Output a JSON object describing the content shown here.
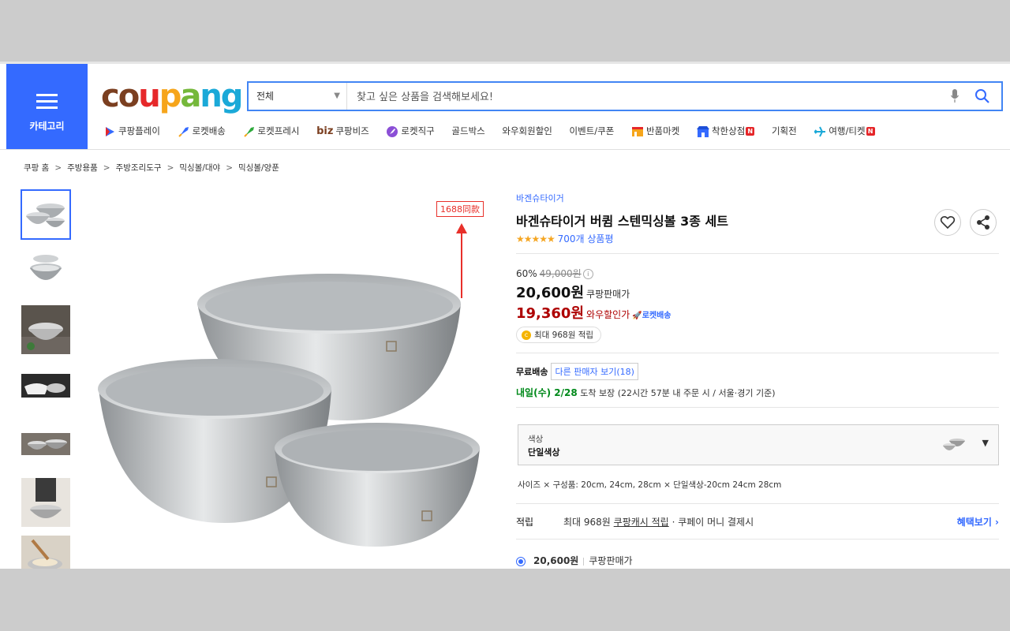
{
  "header": {
    "category_label": "카테고리",
    "search_scope": "전체",
    "search_placeholder": "찾고 싶은 상품을 검색해보세요!",
    "brand_colors": [
      "#7b3f20",
      "#e6282a",
      "#f6a51b",
      "#75b83b",
      "#1ba9d8"
    ]
  },
  "quicknav": [
    {
      "label": "쿠팡플레이",
      "icon": "play-icon"
    },
    {
      "label": "로켓배송",
      "icon": "rocket-icon"
    },
    {
      "label": "로켓프레시",
      "icon": "fresh-rocket-icon"
    },
    {
      "label": "쿠팡비즈",
      "prefix": "biz",
      "icon": "biz-text"
    },
    {
      "label": "로켓직구",
      "icon": "global-rocket-icon"
    },
    {
      "label": "골드박스",
      "icon": ""
    },
    {
      "label": "와우회원할인",
      "icon": ""
    },
    {
      "label": "이벤트/쿠폰",
      "icon": ""
    },
    {
      "label": "반품마켓",
      "icon": "return-market-icon"
    },
    {
      "label": "착한상점",
      "icon": "good-store-icon",
      "badge": "N"
    },
    {
      "label": "기획전",
      "icon": ""
    },
    {
      "label": "여행/티켓",
      "icon": "airplane-icon",
      "badge": "N"
    }
  ],
  "breadcrumb": [
    "쿠팡 홈",
    "주방용품",
    "주방조리도구",
    "믹싱볼/대야",
    "믹싱볼/양푼"
  ],
  "image_tag": "1688同款",
  "product": {
    "brand": "바겐슈타이거",
    "title": "바겐슈타이거 버큄 스텐믹싱볼 3종 세트",
    "stars": "★★★★★",
    "review_count": "700개 상품평",
    "discount_rate": "60%",
    "original_price": "49,000원",
    "sale_price": "20,600원",
    "sale_price_label": "쿠팡판매가",
    "wow_price": "19,360원",
    "wow_price_label": "와우할인가",
    "rocket_label": "로켓배송",
    "reward_badge": "최대 968원 적립",
    "rating_value": 4.5
  },
  "shipping": {
    "free_label": "무료배송",
    "other_sellers": "다른 판매자 보기(18)",
    "arrive_green": "내일(수) 2/28",
    "arrive_suffix": "도착 보장",
    "arrive_detail": "(22시간 57분 내 주문 시 / 서울·경기 기준)"
  },
  "option": {
    "label": "색상",
    "value": "단일색상"
  },
  "size_text": "사이즈 × 구성품: 20cm, 24cm, 28cm × 단일색상-20cm 24cm 28cm",
  "reward_line": {
    "key": "적립",
    "prefix": "최대 968원",
    "link": "쿠팡캐시 적립",
    "suffix": "· 쿠페이 머니 결제시",
    "benefit": "혜택보기 ›"
  },
  "seller_line": {
    "price": "20,600원",
    "label": "쿠팡판매가"
  }
}
